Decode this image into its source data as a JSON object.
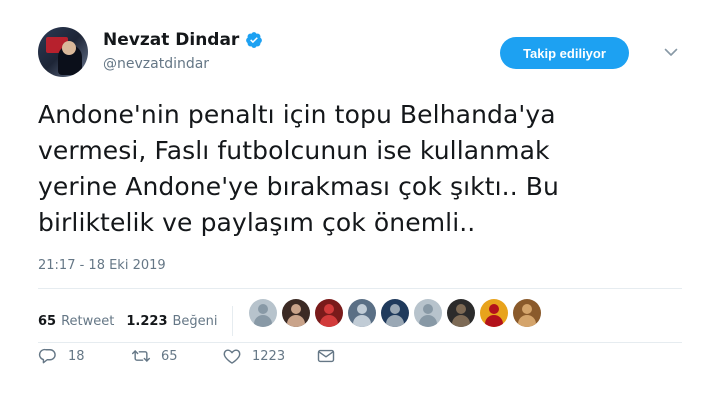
{
  "author": {
    "display_name": "Nevzat Dindar",
    "handle": "@nevzatdindar",
    "verified": true
  },
  "follow_button": {
    "label": "Takip ediliyor"
  },
  "tweet": {
    "lines": [
      "Andone'nin penaltı için topu Belhanda'ya",
      "vermesi, Faslı futbolcunun ise kullanmak",
      "yerine Andone'ye bırakması çok şıktı.. Bu",
      "birliktelik ve paylaşım çok önemli.."
    ],
    "timestamp": "21:17 - 18 Eki 2019"
  },
  "stats": {
    "retweets": {
      "count": "65",
      "label": "Retweet"
    },
    "likes": {
      "count": "1.223",
      "label": "Beğeni"
    }
  },
  "likers": [
    {
      "icon": "default-avatar",
      "bg": "#b7c3cc",
      "fg": "#8899a6"
    },
    {
      "icon": "person-avatar",
      "bg": "#3b2a24",
      "fg": "#c9a38a"
    },
    {
      "icon": "team-logo-avatar",
      "bg": "#7a1b1b",
      "fg": "#d23b3b"
    },
    {
      "icon": "scene-avatar",
      "bg": "#5a6f85",
      "fg": "#c1ccd6"
    },
    {
      "icon": "person-avatar",
      "bg": "#1f3a5c",
      "fg": "#9aa8b5"
    },
    {
      "icon": "default-avatar",
      "bg": "#b7c3cc",
      "fg": "#8899a6"
    },
    {
      "icon": "person-avatar",
      "bg": "#2b2b2b",
      "fg": "#7d6a55"
    },
    {
      "icon": "team-logo-avatar",
      "bg": "#e8a31c",
      "fg": "#b3121b"
    },
    {
      "icon": "person-avatar",
      "bg": "#8a5a2b",
      "fg": "#d4a46b"
    }
  ],
  "actions": {
    "reply": {
      "icon": "reply-icon",
      "count": "18"
    },
    "retweet": {
      "icon": "retweet-icon",
      "count": "65"
    },
    "like": {
      "icon": "heart-icon",
      "count": "1223"
    },
    "message": {
      "icon": "envelope-icon"
    }
  },
  "colors": {
    "accent": "#1da1f2",
    "text": "#14171a",
    "muted": "#657786"
  }
}
